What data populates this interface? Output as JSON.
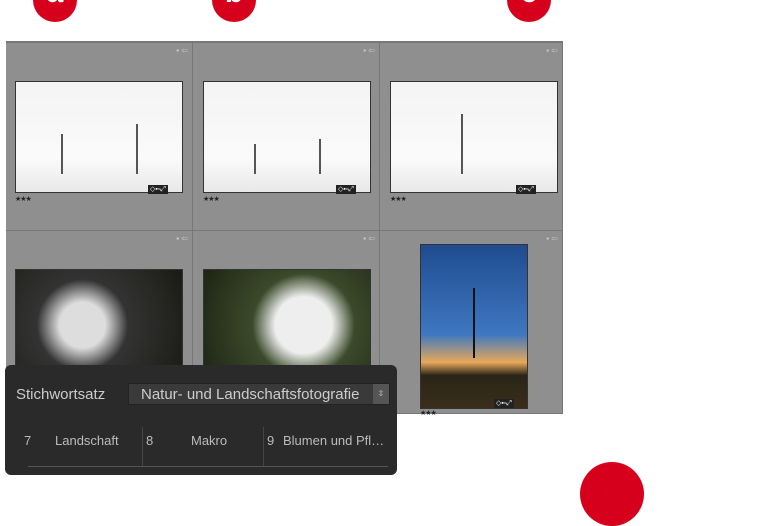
{
  "badges": [
    "a",
    "b",
    "c"
  ],
  "thumbnails": [
    {
      "rating": "★★★"
    },
    {
      "rating": "★★★"
    },
    {
      "rating": "★★★"
    },
    {
      "rating": ""
    },
    {
      "rating": ""
    },
    {
      "rating": "★★★"
    }
  ],
  "keyword_panel": {
    "label": "Stichwortsatz",
    "selected_set": "Natur- und Landschaftsfotografie",
    "keywords": [
      {
        "num": "7",
        "name": "Landschaft"
      },
      {
        "num": "8",
        "name": "Makro"
      },
      {
        "num": "9",
        "name": "Blumen und Pfl…"
      }
    ]
  },
  "colors": {
    "accent": "#d6001c",
    "grid": "#8f8f8f",
    "panel": "#2a2a2a"
  }
}
